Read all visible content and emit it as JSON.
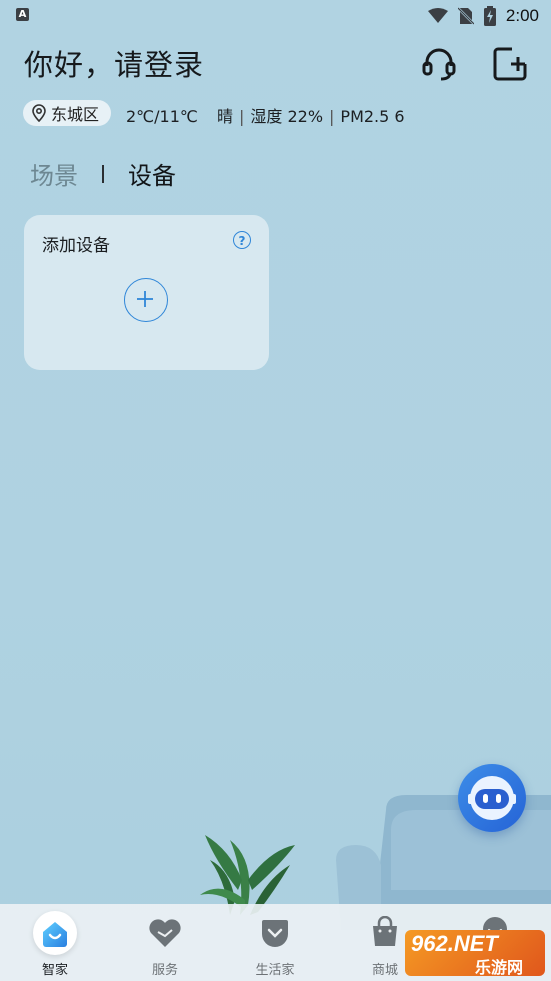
{
  "status_bar": {
    "badge": "A",
    "time": "2:00"
  },
  "header": {
    "greeting": "你好，请登录"
  },
  "weather": {
    "location": "东城区",
    "temperature": "2℃/11℃",
    "condition": "晴",
    "humidity": "湿度 22%",
    "pm25": "PM2.5 6"
  },
  "tabs": [
    {
      "label": "场景",
      "active": false
    },
    {
      "label": "设备",
      "active": true
    }
  ],
  "card": {
    "title": "添加设备",
    "help_symbol": "?"
  },
  "bottom_nav": [
    {
      "label": "智家",
      "icon": "home-icon",
      "active": true
    },
    {
      "label": "服务",
      "icon": "heart-icon",
      "active": false
    },
    {
      "label": "生活家",
      "icon": "pocket-icon",
      "active": false
    },
    {
      "label": "商城",
      "icon": "shopping-bag-icon",
      "active": false
    },
    {
      "label": "",
      "icon": "profile-icon",
      "active": false
    }
  ],
  "watermark": {
    "brand": "962.NET",
    "caption": "乐游网"
  },
  "colors": {
    "accent": "#2f86d8",
    "background": "#aed1e0",
    "card": "#d7e8f0"
  }
}
